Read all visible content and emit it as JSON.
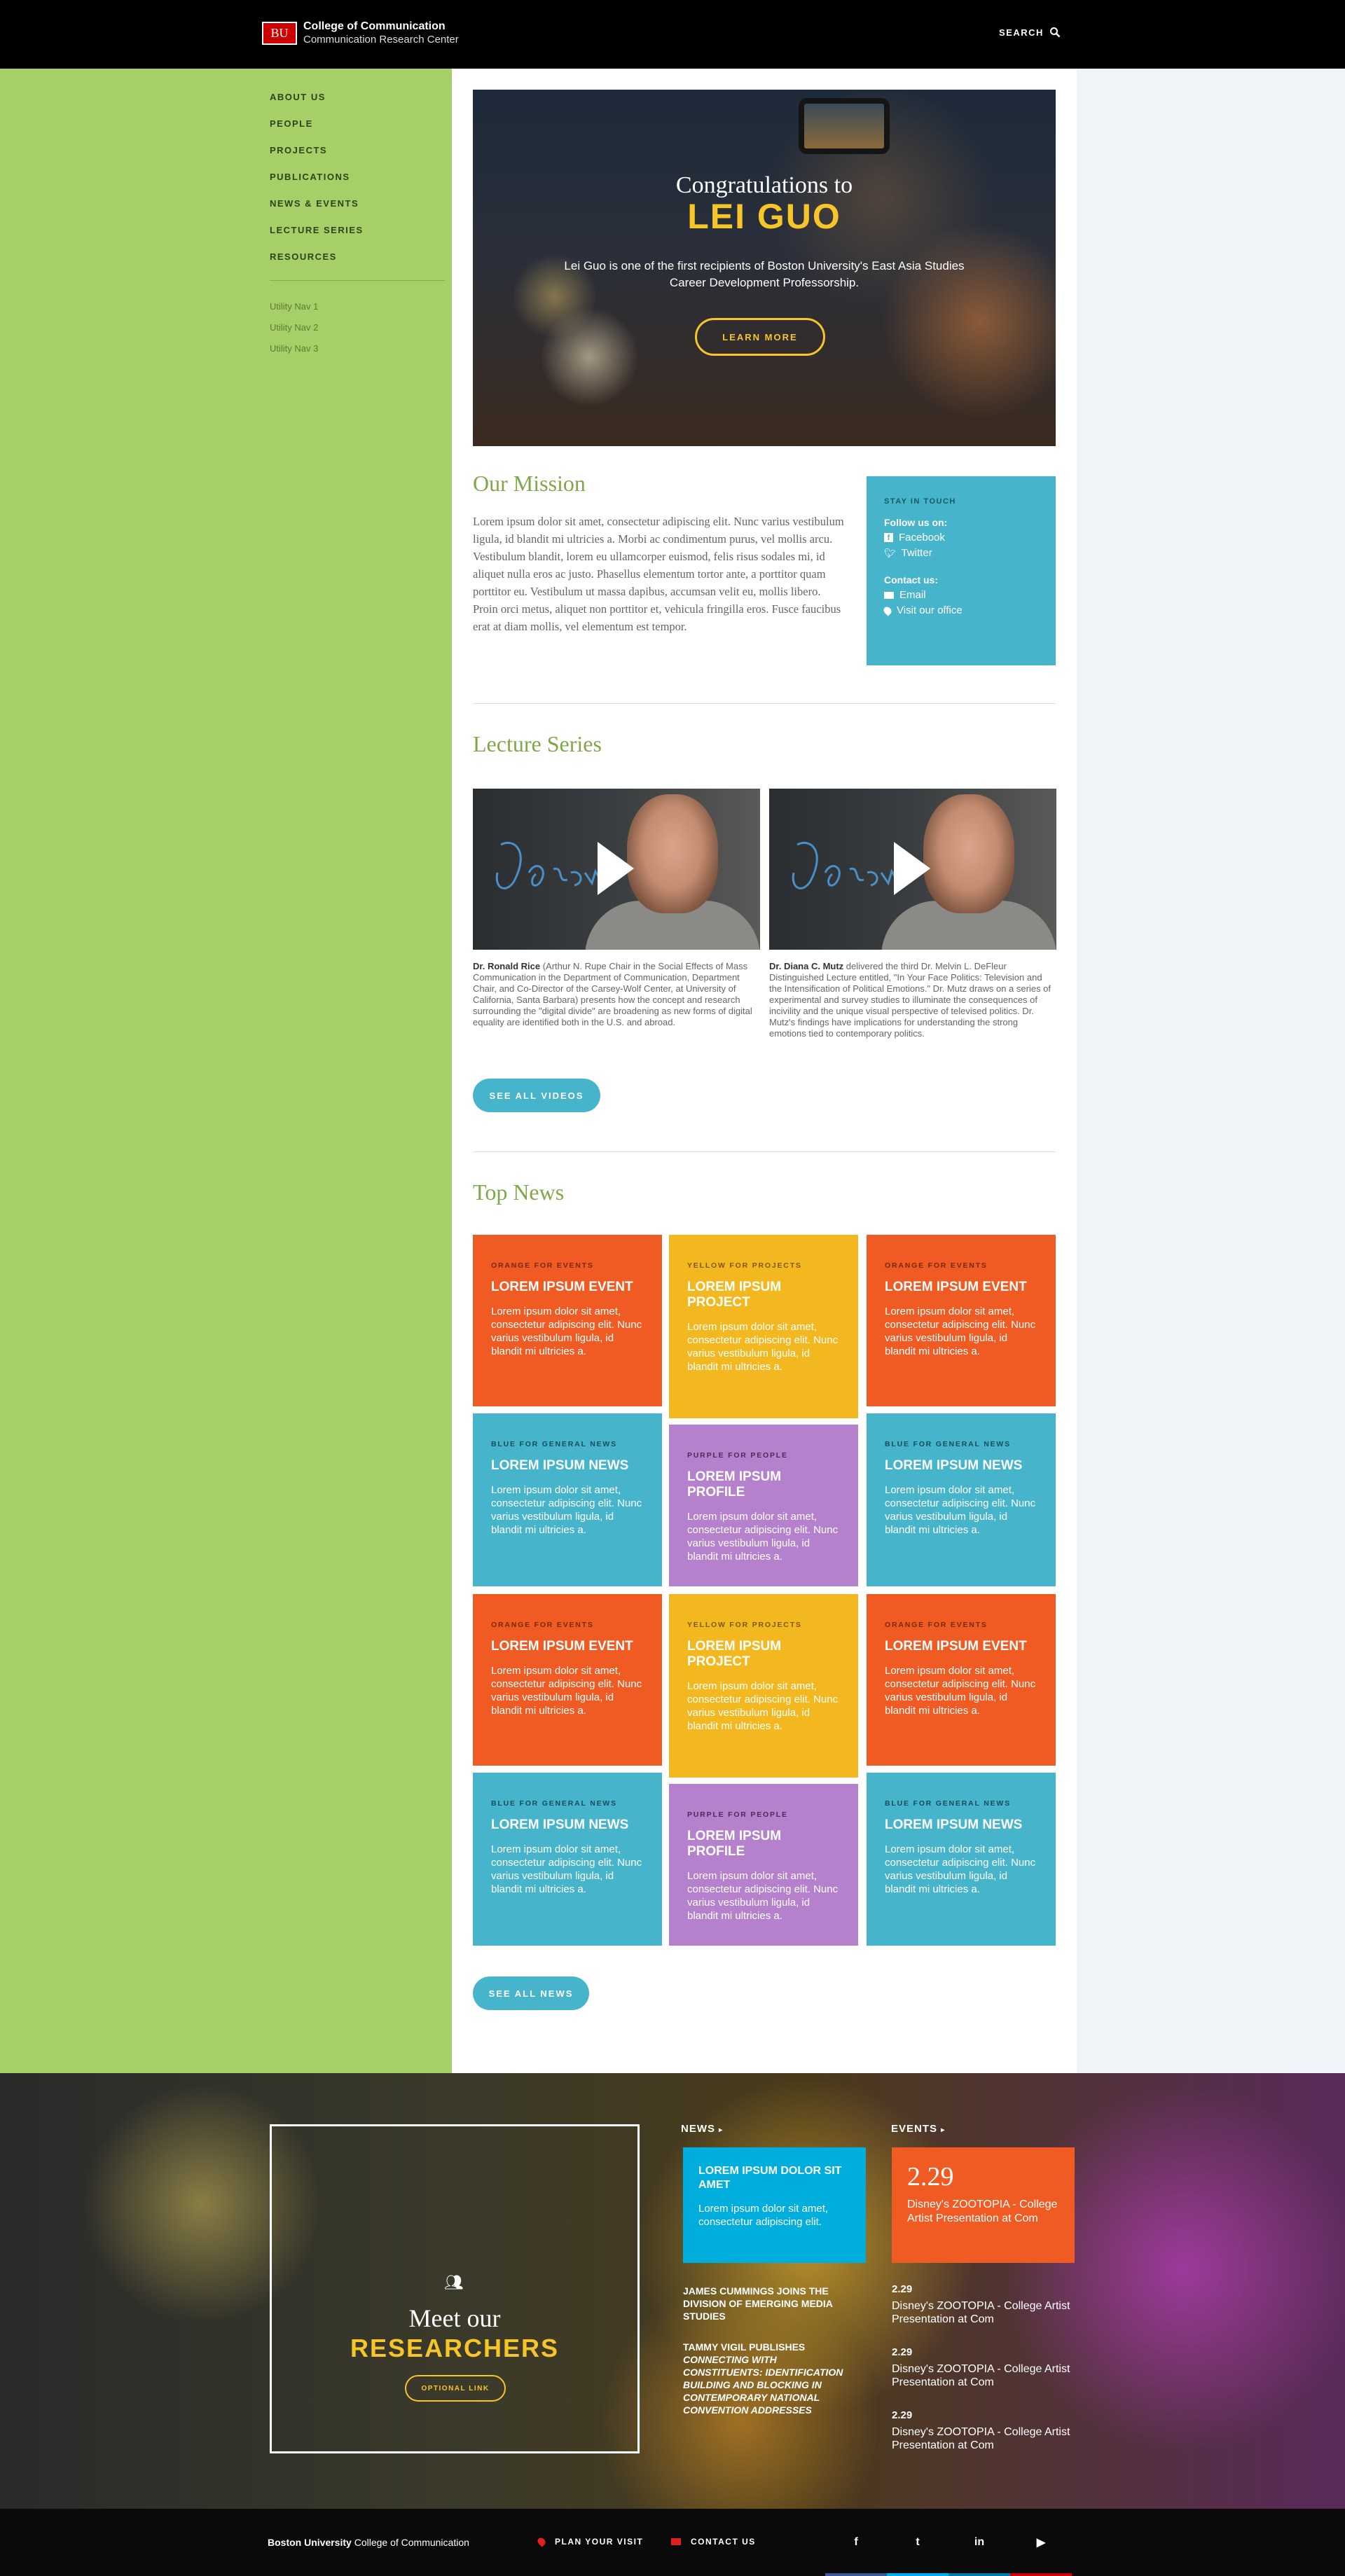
{
  "header": {
    "logo": "BU",
    "title": "College of Communication",
    "subtitle": "Communication Research Center",
    "search_label": "SEARCH"
  },
  "nav": {
    "items": [
      "ABOUT US",
      "PEOPLE",
      "PROJECTS",
      "PUBLICATIONS",
      "NEWS & EVENTS",
      "LECTURE SERIES",
      "RESOURCES"
    ],
    "utility": [
      "Utility Nav 1",
      "Utility Nav 2",
      "Utility Nav 3"
    ]
  },
  "hero": {
    "line1": "Congratulations to",
    "line2": "LEI GUO",
    "text": "Lei Guo is one of the first recipients of Boston University's East Asia Studies Career Development Professorship.",
    "button": "LEARN MORE"
  },
  "mission": {
    "title": "Our Mission",
    "text": "Lorem ipsum dolor sit amet, consectetur adipiscing elit. Nunc varius vestibulum ligula, id blandit mi ultricies a. Morbi ac condimentum purus, vel mollis arcu. Vestibulum blandit, lorem eu ullamcorper euismod, felis risus sodales mi, id aliquet nulla eros ac justo. Phasellus elementum tortor ante, a porttitor quam porttitor eu. Vestibulum ut massa dapibus, accumsan velit eu, mollis libero. Proin orci metus, aliquet non porttitor et, vehicula fringilla eros. Fusce faucibus erat at diam mollis, vel elementum est tempor."
  },
  "touch": {
    "heading": "STAY IN TOUCH",
    "follow": "Follow us on:",
    "facebook": "Facebook",
    "twitter": "Twitter",
    "contact": "Contact us:",
    "email": "Email",
    "visit": "Visit our office"
  },
  "lectures": {
    "title": "Lecture Series",
    "items": [
      {
        "name": "Dr. Ronald Rice",
        "text": " (Arthur N. Rupe Chair in the Social Effects of Mass Communication in the Department of Communication, Department Chair, and Co-Director of the Carsey-Wolf Center, at University of California, Santa Barbara) presents how the concept and research surrounding the \"digital divide\" are broadening as new forms of digital equality are identified both in the U.S. and abroad."
      },
      {
        "name": "Dr. Diana C. Mutz",
        "text": " delivered the third Dr. Melvin L. DeFleur Distinguished Lecture entitled, \"In Your Face Politics: Television and the Intensification of Political Emotions.\" Dr. Mutz draws on a series of experimental and survey studies to illuminate the consequences of incivility and the unique visual perspective of televised politics. Dr. Mutz's findings have implications for understanding the strong emotions tied to contemporary politics."
      }
    ],
    "button": "SEE ALL VIDEOS"
  },
  "news": {
    "title": "Top News",
    "button": "SEE ALL NEWS",
    "tiles": [
      {
        "cat": "ORANGE FOR EVENTS",
        "title": "LOREM IPSUM EVENT",
        "text": "Lorem ipsum dolor sit amet, consectetur adipiscing elit. Nunc varius vestibulum ligula, id blandit mi ultricies a."
      },
      {
        "cat": "YELLOW FOR PROJECTS",
        "title": "LOREM IPSUM PROJECT",
        "text": "Lorem ipsum dolor sit amet, consectetur adipiscing elit. Nunc varius vestibulum ligula, id blandit mi ultricies a."
      },
      {
        "cat": "ORANGE FOR EVENTS",
        "title": "LOREM IPSUM EVENT",
        "text": "Lorem ipsum dolor sit amet, consectetur adipiscing elit. Nunc varius vestibulum ligula, id blandit mi ultricies a."
      },
      {
        "cat": "BLUE FOR GENERAL NEWS",
        "title": "LOREM IPSUM NEWS",
        "text": "Lorem ipsum dolor sit amet, consectetur adipiscing elit. Nunc varius vestibulum ligula, id blandit mi ultricies a."
      },
      {
        "cat": "PURPLE FOR PEOPLE",
        "title": "LOREM IPSUM PROFILE",
        "text": "Lorem ipsum dolor sit amet, consectetur adipiscing elit. Nunc varius vestibulum ligula, id blandit mi ultricies a."
      },
      {
        "cat": "BLUE FOR GENERAL NEWS",
        "title": "LOREM IPSUM NEWS",
        "text": "Lorem ipsum dolor sit amet, consectetur adipiscing elit. Nunc varius vestibulum ligula, id blandit mi ultricies a."
      },
      {
        "cat": "ORANGE FOR EVENTS",
        "title": "LOREM IPSUM EVENT",
        "text": "Lorem ipsum dolor sit amet, consectetur adipiscing elit. Nunc varius vestibulum ligula, id blandit mi ultricies a."
      },
      {
        "cat": "YELLOW FOR PROJECTS",
        "title": "LOREM IPSUM PROJECT",
        "text": "Lorem ipsum dolor sit amet, consectetur adipiscing elit. Nunc varius vestibulum ligula, id blandit mi ultricies a."
      },
      {
        "cat": "ORANGE FOR EVENTS",
        "title": "LOREM IPSUM EVENT",
        "text": "Lorem ipsum dolor sit amet, consectetur adipiscing elit. Nunc varius vestibulum ligula, id blandit mi ultricies a."
      },
      {
        "cat": "BLUE FOR GENERAL NEWS",
        "title": "LOREM IPSUM NEWS",
        "text": "Lorem ipsum dolor sit amet, consectetur adipiscing elit. Nunc varius vestibulum ligula, id blandit mi ultricies a."
      },
      {
        "cat": "PURPLE FOR PEOPLE",
        "title": "LOREM IPSUM PROFILE",
        "text": "Lorem ipsum dolor sit amet, consectetur adipiscing elit. Nunc varius vestibulum ligula, id blandit mi ultricies a."
      },
      {
        "cat": "BLUE FOR GENERAL NEWS",
        "title": "LOREM IPSUM NEWS",
        "text": "Lorem ipsum dolor sit amet, consectetur adipiscing elit. Nunc varius vestibulum ligula, id blandit mi ultricies a."
      }
    ]
  },
  "researchers": {
    "line1": "Meet our",
    "line2": "RESEARCHERS",
    "button": "OPTIONAL LINK"
  },
  "footer_news": {
    "heading": "NEWS",
    "card_title": "LOREM IPSUM DOLOR SIT AMET",
    "card_text": "Lorem ipsum dolor sit amet, consectetur adipiscing elit.",
    "link1": "JAMES CUMMINGS JOINS THE DIVISION OF EMERGING MEDIA STUDIES",
    "link2_prefix": "TAMMY VIGIL PUBLISHES ",
    "link2_italic": "CONNECTING WITH CONSTITUENTS: IDENTIFICATION BUILDING AND BLOCKING IN CONTEMPORARY NATIONAL CONVENTION ADDRESSES"
  },
  "footer_events": {
    "heading": "EVENTS",
    "card_date": "2.29",
    "card_text": "Disney's ZOOTOPIA - College Artist Presentation at Com",
    "items": [
      {
        "date": "2.29",
        "text": "Disney's ZOOTOPIA - College Artist Presentation at Com"
      },
      {
        "date": "2.29",
        "text": "Disney's ZOOTOPIA - College Artist Presentation at Com"
      },
      {
        "date": "2.29",
        "text": "Disney's ZOOTOPIA - College Artist Presentation at Com"
      }
    ]
  },
  "footer": {
    "bu": "Boston University",
    "college": " College of Communication",
    "plan": "PLAN YOUR VISIT",
    "contact": "CONTACT US",
    "social": [
      {
        "icon": "facebook-icon",
        "glyph": "f",
        "color": "#3b5998"
      },
      {
        "icon": "twitter-icon",
        "glyph": "t",
        "color": "#00aced"
      },
      {
        "icon": "linkedin-icon",
        "glyph": "in",
        "color": "#0077b5"
      },
      {
        "icon": "youtube-icon",
        "glyph": "▶",
        "color": "#cc0000"
      }
    ]
  },
  "colors": {
    "green": "#a6cf67",
    "orange": "#f05a23",
    "yellow": "#f3b81f",
    "blue": "#46b5cb",
    "purple": "#b580cc",
    "gold": "#f6c52a"
  }
}
